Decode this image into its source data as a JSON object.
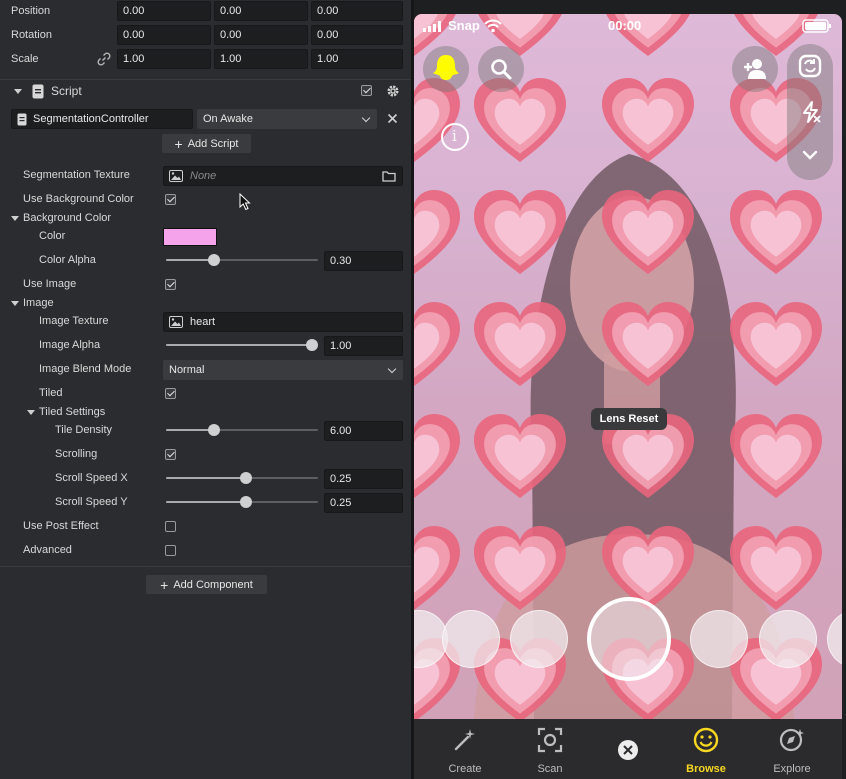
{
  "inspector": {
    "transform": {
      "rows": [
        {
          "label": "Position",
          "values": [
            "0.00",
            "0.00",
            "0.00"
          ]
        },
        {
          "label": "Rotation",
          "values": [
            "0.00",
            "0.00",
            "0.00"
          ]
        },
        {
          "label": "Scale",
          "values": [
            "1.00",
            "1.00",
            "1.00"
          ]
        }
      ]
    },
    "script": {
      "title": "Script",
      "component_name": "SegmentationController",
      "event": "On Awake",
      "add_script_label": "Add Script"
    },
    "props": {
      "segmentation_texture": {
        "label": "Segmentation Texture",
        "value": "None"
      },
      "use_background_color": {
        "label": "Use Background Color",
        "checked": true
      },
      "background_color_group": "Background Color",
      "color": {
        "label": "Color",
        "value": "#f5a3ea"
      },
      "color_alpha": {
        "label": "Color Alpha",
        "value": "0.30",
        "fraction": 0.3
      },
      "use_image": {
        "label": "Use Image",
        "checked": true
      },
      "image_group": "Image",
      "image_texture": {
        "label": "Image Texture",
        "value": "heart"
      },
      "image_alpha": {
        "label": "Image Alpha",
        "value": "1.00",
        "fraction": 1.0
      },
      "image_blend_mode": {
        "label": "Image Blend Mode",
        "value": "Normal"
      },
      "tiled": {
        "label": "Tiled",
        "checked": true
      },
      "tiled_settings_group": "Tiled Settings",
      "tile_density": {
        "label": "Tile Density",
        "value": "6.00",
        "fraction": 0.3
      },
      "scrolling": {
        "label": "Scrolling",
        "checked": true
      },
      "scroll_speed_x": {
        "label": "Scroll Speed X",
        "value": "0.25",
        "fraction": 0.53
      },
      "scroll_speed_y": {
        "label": "Scroll Speed Y",
        "value": "0.25",
        "fraction": 0.53
      },
      "use_post_effect": {
        "label": "Use Post Effect",
        "checked": false
      },
      "advanced": {
        "label": "Advanced",
        "checked": false
      }
    },
    "add_component_label": "Add Component"
  },
  "preview": {
    "carrier": "Snap",
    "time": "00:00",
    "lens_reset": "Lens Reset",
    "nav": [
      {
        "label": "Create",
        "icon": "magic-wand-icon"
      },
      {
        "label": "Scan",
        "icon": "scan-icon"
      },
      {
        "label": "Browse",
        "icon": "smiley-icon",
        "active": true
      },
      {
        "label": "Explore",
        "icon": "explore-icon"
      }
    ]
  },
  "colors": {
    "accent_yellow": "#f7d722",
    "heart_outer": "#e64d5e",
    "heart_mid": "#f29aa5",
    "heart_inner": "#f8c9d2"
  }
}
